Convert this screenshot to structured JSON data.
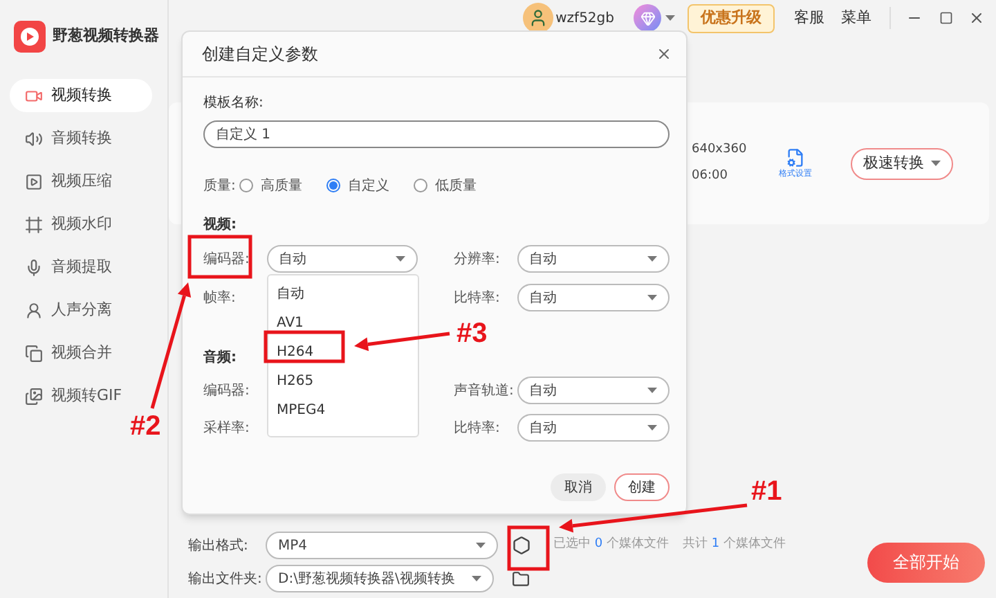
{
  "app": {
    "name": "野葱视频转换器"
  },
  "sidebar": {
    "items": [
      {
        "label": "视频转换",
        "selected": true
      },
      {
        "label": "音频转换",
        "selected": false
      },
      {
        "label": "视频压缩",
        "selected": false
      },
      {
        "label": "视频水印",
        "selected": false
      },
      {
        "label": "音频提取",
        "selected": false
      },
      {
        "label": "人声分离",
        "selected": false
      },
      {
        "label": "视频合并",
        "selected": false
      },
      {
        "label": "视频转GIF",
        "selected": false
      }
    ]
  },
  "topbar": {
    "username": "wzf52gb",
    "upgrade": "优惠升级",
    "links": [
      "客服",
      "菜单"
    ]
  },
  "file_card": {
    "resolution": "640x360",
    "duration": "06:00",
    "format_settings": "格式设置",
    "convert_button": "极速转换"
  },
  "output": {
    "format_label": "输出格式:",
    "format": "MP4",
    "folder_label": "输出文件夹:",
    "folder": "D:\\野葱视频转换器\\视频转换",
    "selected_prefix": "已选中",
    "selected_count": "0",
    "selected_suffix": "个媒体文件",
    "total_prefix": "共计",
    "total_count": "1",
    "total_suffix": "个媒体文件",
    "start_button": "全部开始"
  },
  "dialog": {
    "title": "创建自定义参数",
    "name_label": "模板名称:",
    "name_value": "自定义 1",
    "quality_label": "质量:",
    "quality_options": [
      {
        "label": "高质量",
        "selected": false
      },
      {
        "label": "自定义",
        "selected": true
      },
      {
        "label": "低质量",
        "selected": false
      }
    ],
    "video_heading": "视频:",
    "video_fields": [
      {
        "label": "编码器:",
        "value": "自动"
      },
      {
        "label": "分辨率:",
        "value": "自动"
      },
      {
        "label": "帧率:"
      },
      {
        "label": "比特率:",
        "value": "自动"
      }
    ],
    "audio_heading": "音频:",
    "audio_fields": [
      {
        "label": "编码器:"
      },
      {
        "label": "声音轨道:",
        "value": "自动"
      },
      {
        "label": "采样率:"
      },
      {
        "label": "比特率:",
        "value": "自动"
      }
    ],
    "dropdown": {
      "options": [
        "自动",
        "AV1",
        "H264",
        "H265",
        "MPEG4"
      ]
    },
    "buttons": [
      "取消",
      "创建"
    ]
  },
  "annotations": [
    "#1",
    "#2",
    "#3"
  ]
}
